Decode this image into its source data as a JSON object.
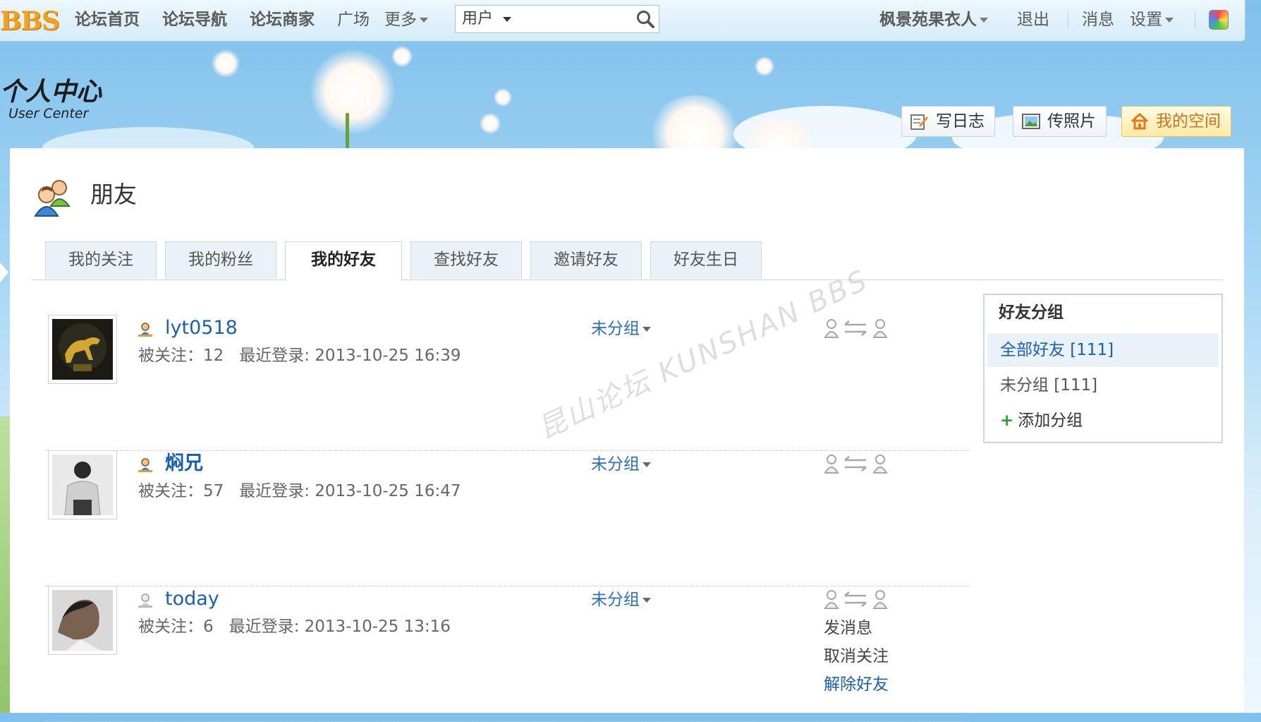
{
  "topbar": {
    "logo": "BBS",
    "nav": [
      "论坛首页",
      "论坛导航",
      "论坛商家",
      "广场",
      "更多"
    ],
    "search": {
      "scope": "用户"
    },
    "username": "枫景苑果衣人",
    "logout": "退出",
    "messages": "消息",
    "settings": "设置"
  },
  "banner": {
    "title": "个人中心",
    "subtitle": "User Center",
    "buttons": [
      "写日志",
      "传照片",
      "我的空间"
    ]
  },
  "page": {
    "title": "朋友",
    "tabs": [
      "我的关注",
      "我的粉丝",
      "我的好友",
      "查找好友",
      "邀请好友",
      "好友生日"
    ],
    "active_tab": "我的好友"
  },
  "friends": [
    {
      "name": "lyt0518",
      "followers_label": "被关注：12",
      "last_login": "最近登录: 2013-10-25 16:39",
      "group": "未分组"
    },
    {
      "name": "焖兄",
      "followers_label": "被关注：57",
      "last_login": "最近登录: 2013-10-25 16:47",
      "group": "未分组"
    },
    {
      "name": "today",
      "followers_label": "被关注：6",
      "last_login": "最近登录: 2013-10-25 13:16",
      "group": "未分组",
      "actions": [
        "发消息",
        "取消关注",
        "解除好友"
      ]
    }
  ],
  "sidebar": {
    "title": "好友分组",
    "items": [
      "全部好友 [111]",
      "未分组 [111]",
      "添加分组"
    ]
  },
  "watermark": "昆山论坛 KUNSHAN BBS",
  "colors": {
    "link": "#1a5fb4",
    "accent": "#f2a21b",
    "tab_bg": "#eaf1f7"
  }
}
